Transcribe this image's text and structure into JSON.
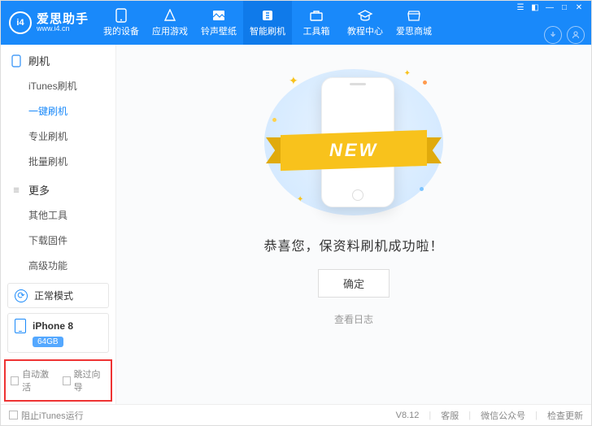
{
  "brand": {
    "name": "爱思助手",
    "url": "www.i4.cn",
    "logo_text": "i4"
  },
  "tabs": [
    {
      "id": "device",
      "label": "我的设备"
    },
    {
      "id": "apps",
      "label": "应用游戏"
    },
    {
      "id": "ring",
      "label": "铃声壁纸"
    },
    {
      "id": "flash",
      "label": "智能刷机"
    },
    {
      "id": "toolbox",
      "label": "工具箱"
    },
    {
      "id": "tutorial",
      "label": "教程中心"
    },
    {
      "id": "store",
      "label": "爱思商城"
    }
  ],
  "active_tab": "flash",
  "sidebar": {
    "section1": {
      "title": "刷机",
      "items": [
        "iTunes刷机",
        "一键刷机",
        "专业刷机",
        "批量刷机"
      ],
      "selected": "一键刷机"
    },
    "section2": {
      "title": "更多",
      "items": [
        "其他工具",
        "下载固件",
        "高级功能"
      ]
    },
    "mode": "正常模式",
    "device": {
      "name": "iPhone 8",
      "storage": "64GB"
    },
    "options": {
      "auto_activate": "自动激活",
      "skip_wizard": "跳过向导"
    }
  },
  "main": {
    "ribbon": "NEW",
    "message": "恭喜您，保资料刷机成功啦！",
    "ok": "确定",
    "view_log": "查看日志"
  },
  "footer": {
    "block_itunes": "阻止iTunes运行",
    "version": "V8.12",
    "support": "客服",
    "wechat": "微信公众号",
    "update": "检查更新"
  }
}
